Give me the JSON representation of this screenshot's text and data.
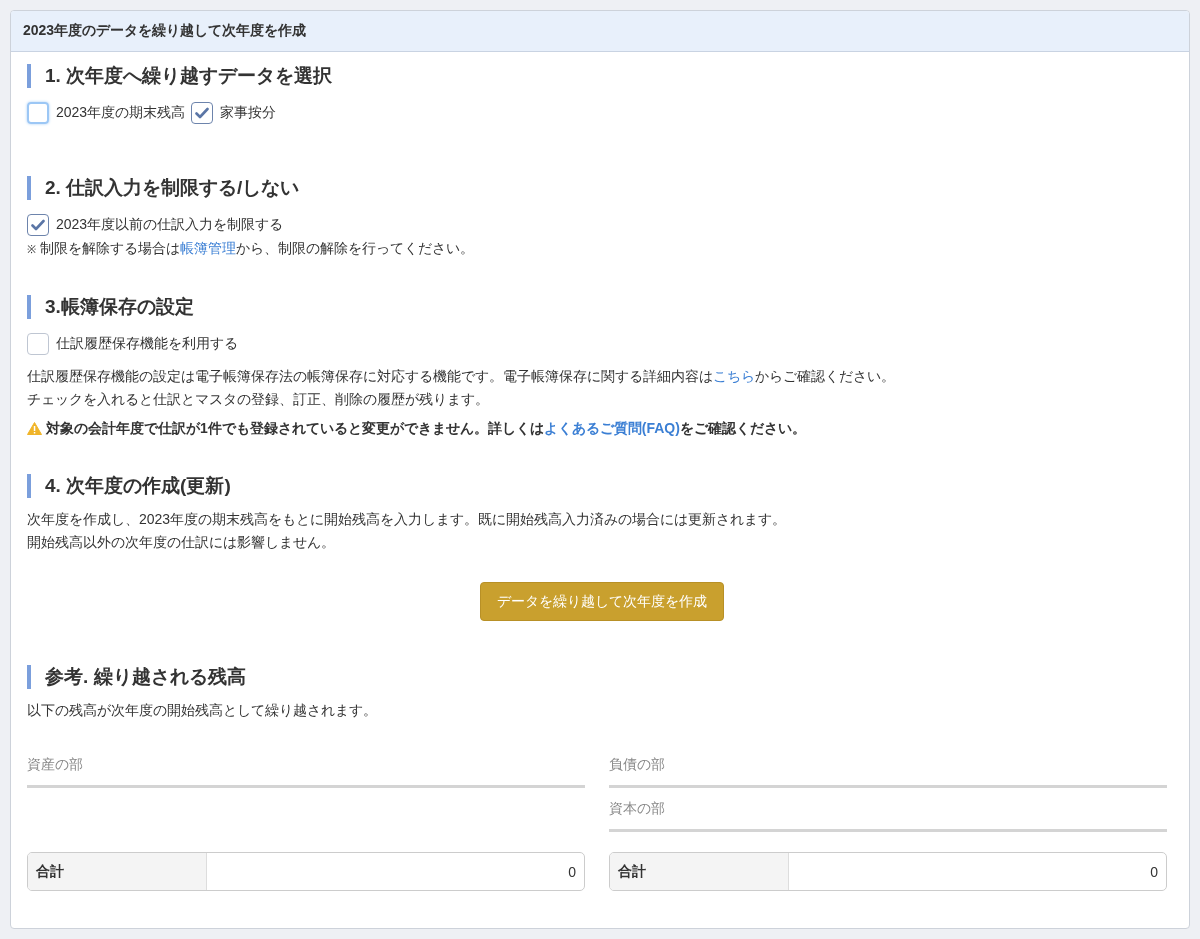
{
  "panel": {
    "title": "2023年度のデータを繰り越して次年度を作成"
  },
  "sections": [
    {
      "heading": "1. 次年度へ繰り越すデータを選択",
      "items": [
        {
          "kind": "checkboxes",
          "checkboxes": [
            {
              "label": "2023年度の期末残高",
              "checked": false,
              "focused": true
            },
            {
              "label": "家事按分",
              "checked": true,
              "focused": false
            }
          ]
        }
      ]
    },
    {
      "heading": "2. 仕訳入力を制限する/しない",
      "items": [
        {
          "kind": "checkboxes",
          "checkboxes": [
            {
              "label": "2023年度以前の仕訳入力を制限する",
              "checked": true,
              "focused": false
            }
          ]
        },
        {
          "kind": "note",
          "parts": [
            {
              "kind": "mark",
              "text": "※"
            },
            {
              "kind": "text",
              "text": " 制限を解除する場合は"
            },
            {
              "kind": "link",
              "text": "帳簿管理"
            },
            {
              "kind": "text",
              "text": "から、制限の解除を行ってください。"
            }
          ]
        }
      ]
    },
    {
      "heading": "3.帳簿保存の設定",
      "items": [
        {
          "kind": "checkboxes",
          "checkboxes": [
            {
              "label": "仕訳履歴保存機能を利用する",
              "checked": false,
              "focused": false
            }
          ]
        },
        {
          "kind": "paragraph",
          "parts": [
            {
              "kind": "text",
              "text": "仕訳履歴保存機能の設定は電子帳簿保存法の帳簿保存に対応する機能です。電子帳簿保存に関する詳細内容は"
            },
            {
              "kind": "link",
              "text": "こちら"
            },
            {
              "kind": "text",
              "text": "からご確認ください。"
            }
          ]
        },
        {
          "kind": "paragraph",
          "parts": [
            {
              "kind": "text",
              "text": "チェックを入れると仕訳とマスタの登録、訂正、削除の履歴が残ります。"
            }
          ]
        },
        {
          "kind": "warning",
          "parts": [
            {
              "kind": "text",
              "text": "対象の会計年度で仕訳が1件でも登録されていると変更ができません。詳しくは"
            },
            {
              "kind": "link",
              "text": "よくあるご質問(FAQ)"
            },
            {
              "kind": "text",
              "text": "をご確認ください。"
            }
          ]
        }
      ]
    },
    {
      "heading": "4. 次年度の作成(更新)",
      "items": [
        {
          "kind": "paragraph",
          "parts": [
            {
              "kind": "text",
              "text": "次年度を作成し、2023年度の期末残高をもとに開始残高を入力します。既に開始残高入力済みの場合には更新されます。"
            }
          ]
        },
        {
          "kind": "paragraph",
          "parts": [
            {
              "kind": "text",
              "text": "開始残高以外の次年度の仕訳には影響しません。"
            }
          ]
        },
        {
          "kind": "button",
          "label": "データを繰り越して次年度を作成"
        }
      ]
    },
    {
      "heading": "参考. 繰り越される残高",
      "items": [
        {
          "kind": "paragraph",
          "parts": [
            {
              "kind": "text",
              "text": "以下の残高が次年度の開始残高として繰り越されます。"
            }
          ]
        },
        {
          "kind": "balances",
          "columns": [
            {
              "groups": [
                "資産の部"
              ],
              "total_label": "合計",
              "total_value": "0"
            },
            {
              "groups": [
                "負債の部",
                "資本の部"
              ],
              "total_label": "合計",
              "total_value": "0"
            }
          ]
        }
      ]
    }
  ]
}
